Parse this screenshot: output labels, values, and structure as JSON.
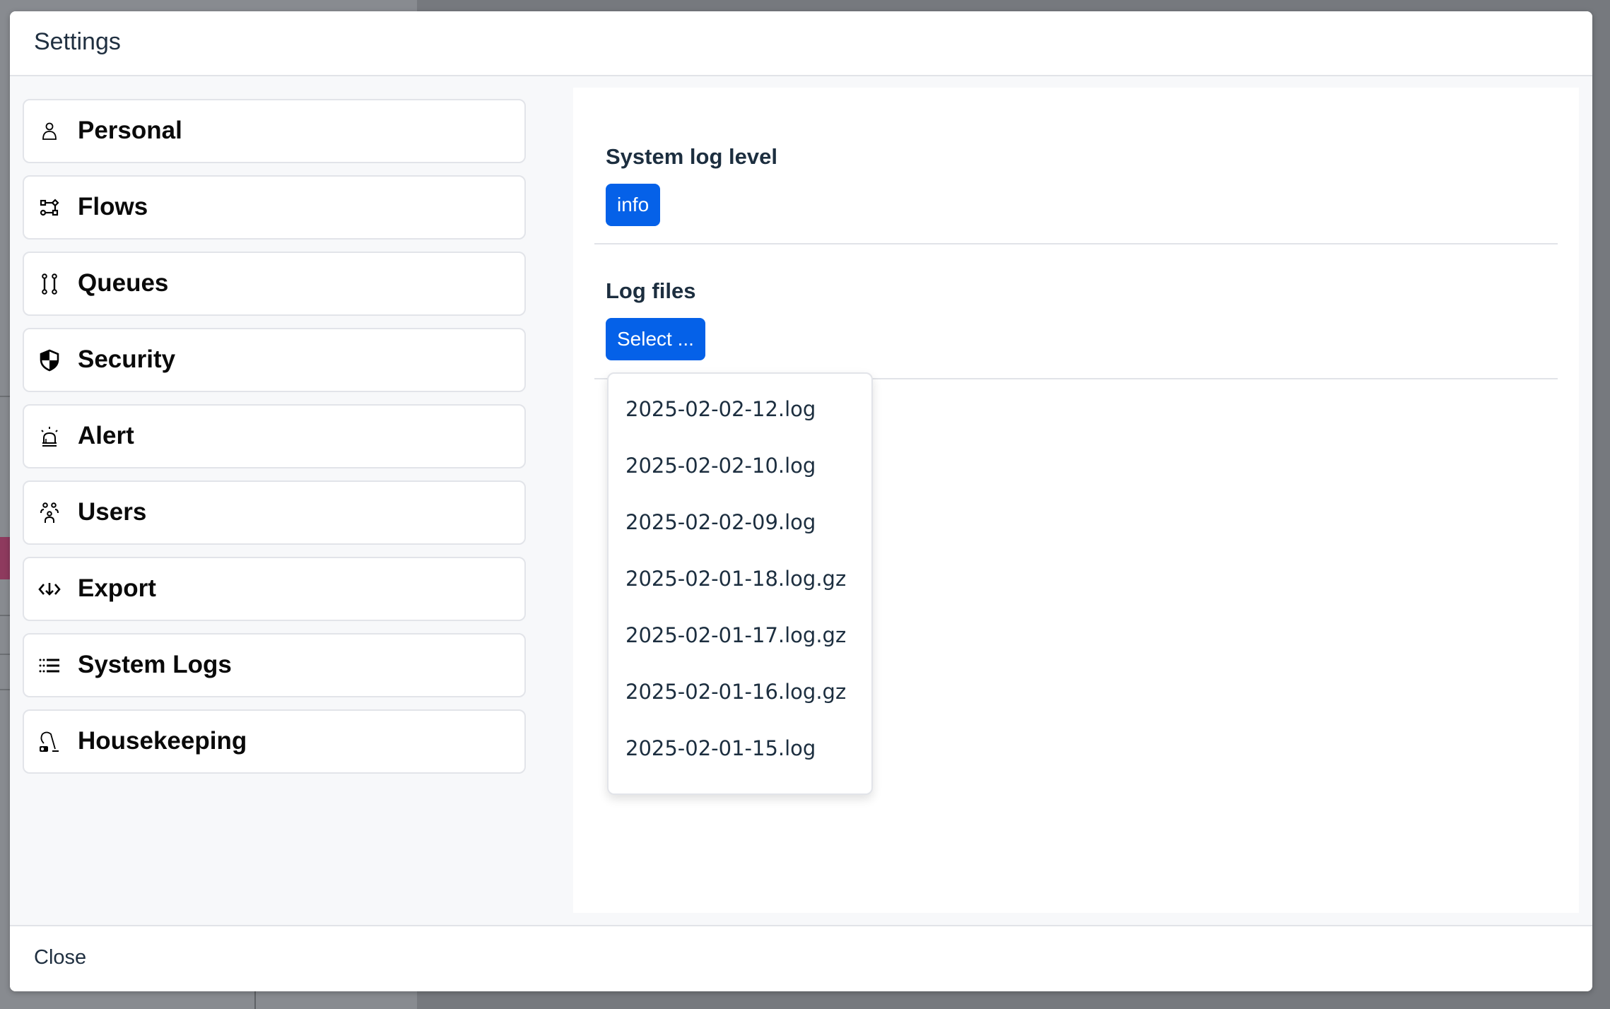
{
  "modal": {
    "title": "Settings",
    "footer": {
      "close_label": "Close"
    }
  },
  "sidebar": {
    "items": [
      {
        "label": "Personal",
        "icon": "person-icon"
      },
      {
        "label": "Flows",
        "icon": "flow-icon"
      },
      {
        "label": "Queues",
        "icon": "queue-icon"
      },
      {
        "label": "Security",
        "icon": "shield-icon"
      },
      {
        "label": "Alert",
        "icon": "siren-icon"
      },
      {
        "label": "Users",
        "icon": "users-icon"
      },
      {
        "label": "Export",
        "icon": "export-icon"
      },
      {
        "label": "System Logs",
        "icon": "list-icon"
      },
      {
        "label": "Housekeeping",
        "icon": "vacuum-icon"
      }
    ]
  },
  "system_logs": {
    "log_level": {
      "heading": "System log level",
      "value": "info"
    },
    "log_files": {
      "heading": "Log files",
      "select_label": "Select ...",
      "options": [
        "2025-02-02-12.log",
        "2025-02-02-10.log",
        "2025-02-02-09.log",
        "2025-02-01-18.log.gz",
        "2025-02-01-17.log.gz",
        "2025-02-01-16.log.gz",
        "2025-02-01-15.log"
      ]
    }
  },
  "colors": {
    "accent": "#0561e8",
    "text_dark": "#1c2e3f",
    "border": "#e2e4e9"
  }
}
